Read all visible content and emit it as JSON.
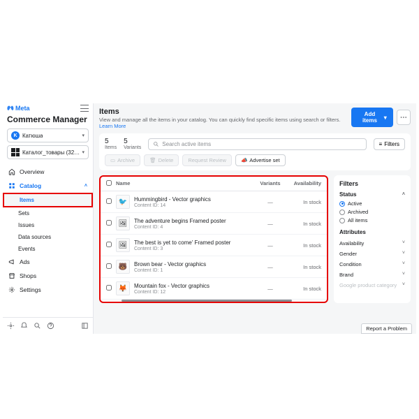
{
  "brand": "Meta",
  "app_title": "Commerce Manager",
  "account": {
    "initial": "K",
    "name": "Катюша"
  },
  "catalog_select": "Каталог_товары (321993346...",
  "nav": {
    "overview": "Overview",
    "catalog": "Catalog",
    "catalog_sub": [
      "Items",
      "Sets",
      "Issues",
      "Data sources",
      "Events"
    ],
    "ads": "Ads",
    "shops": "Shops",
    "settings": "Settings"
  },
  "main": {
    "title": "Items",
    "subtitle": "View and manage all the items in your catalog. You can quickly find specific items using search or filters.",
    "learn_more": "Learn More",
    "add_items": "Add items",
    "stats": [
      {
        "num": "5",
        "label": "Items"
      },
      {
        "num": "5",
        "label": "Variants"
      }
    ],
    "search_ph": "Search active items",
    "filters_btn": "Filters",
    "actions": [
      "Archive",
      "Delete",
      "Request Review",
      "Advertise set"
    ]
  },
  "table": {
    "cols": [
      "Name",
      "Variants",
      "Availability"
    ],
    "rows": [
      {
        "name": "Hummingbird - Vector graphics",
        "cid": "Content ID: 14",
        "variants": "—",
        "avail": "In stock",
        "thumb": "🐦"
      },
      {
        "name": "The adventure begins Framed poster",
        "cid": "Content ID: 4",
        "variants": "—",
        "avail": "In stock",
        "thumb": "🖼"
      },
      {
        "name": "The best is yet to come' Framed poster",
        "cid": "Content ID: 3",
        "variants": "—",
        "avail": "In stock",
        "thumb": "🖼"
      },
      {
        "name": "Brown bear - Vector graphics",
        "cid": "Content ID: 1",
        "variants": "—",
        "avail": "In stock",
        "thumb": "🐻"
      },
      {
        "name": "Mountain fox - Vector graphics",
        "cid": "Content ID: 12",
        "variants": "—",
        "avail": "In stock",
        "thumb": "🦊"
      }
    ]
  },
  "filters": {
    "title": "Filters",
    "status_label": "Status",
    "status_opts": [
      "Active",
      "Archived",
      "All items"
    ],
    "attrs_label": "Attributes",
    "attrs": [
      "Availability",
      "Gender",
      "Condition",
      "Brand",
      "Google product category"
    ]
  },
  "report": "Report a Problem"
}
